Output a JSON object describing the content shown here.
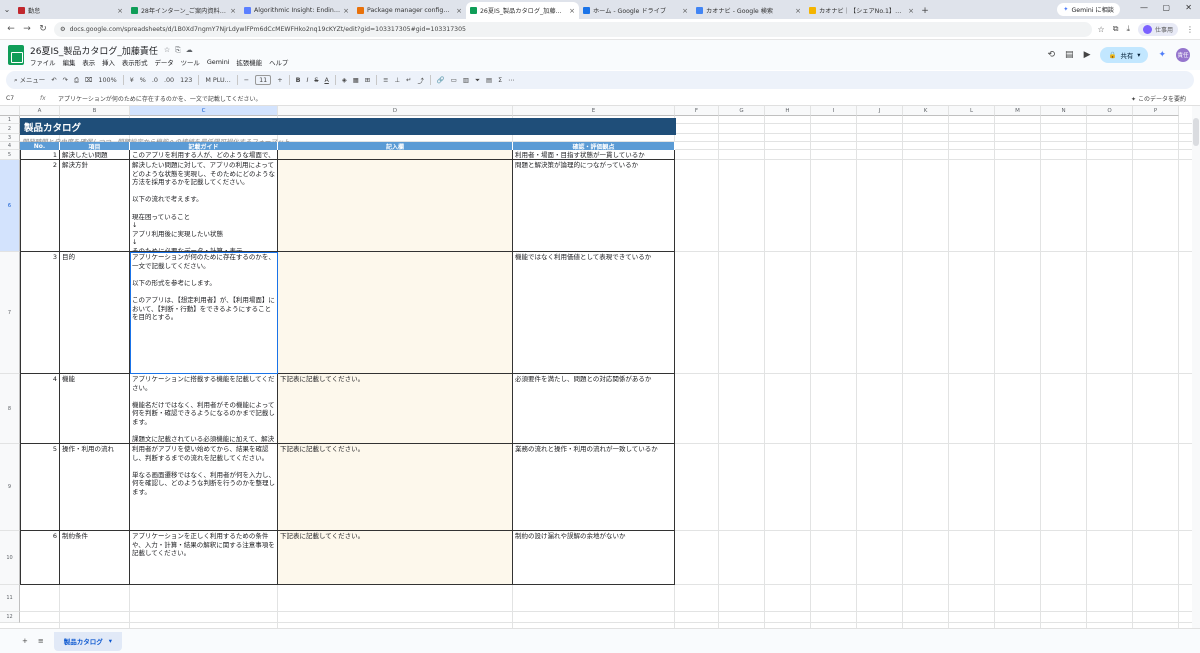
{
  "browser": {
    "tabs": [
      {
        "label": "勤怠",
        "color": "#c1272d",
        "active": false
      },
      {
        "label": "28年インターン_ご案内資料 - Go",
        "color": "#0f9d58",
        "active": false
      },
      {
        "label": "Algorithmic Insight: Ending To",
        "color": "#5b7fff",
        "active": false
      },
      {
        "label": "Package manager configuratio",
        "color": "#e8710a",
        "active": false
      },
      {
        "label": "26夏IS_製品カタログ_加藤責任",
        "color": "#0f9d58",
        "active": true
      },
      {
        "label": "ホーム - Google ドライブ",
        "color": "#1a73e8",
        "active": false
      },
      {
        "label": "カオナビ - Google 検索",
        "color": "#4285f4",
        "active": false
      },
      {
        "label": "カオナビ｜【シェアNo.1】タレントマネ",
        "color": "#f4b400",
        "active": false
      }
    ],
    "gemini_button": "Gemini に相談",
    "url": "docs.google.com/spreadsheets/d/1B0Xd7ngmY7NjrLdywlFPm6dCcMEWFHko2nq19cKYZt/edit?gid=103317305#gid=103317305",
    "profile_label": "仕事用"
  },
  "doc": {
    "title": "26夏IS_製品カタログ_加藤責任",
    "menu": [
      "ファイル",
      "編集",
      "表示",
      "挿入",
      "表示形式",
      "データ",
      "ツール",
      "Gemini",
      "拡張機能",
      "ヘルプ"
    ],
    "share_label": "共有",
    "avatar_label": "責任"
  },
  "toolbar": {
    "menu_label": "メニュー",
    "zoom": "100%",
    "currency": "¥",
    "percent": "%",
    "decimal_dec": ".0",
    "decimal_inc": ".00",
    "format_123": "123",
    "font": "M PLU...",
    "font_size": "11"
  },
  "formula_bar": {
    "cell_ref": "C7",
    "content": "アプリケーションが何のために存在するのかを、一文で記載してください。",
    "right_label": "このデータを要約"
  },
  "columns": [
    "A",
    "B",
    "C",
    "D",
    "E",
    "F",
    "G",
    "H",
    "I",
    "J",
    "K",
    "L",
    "M",
    "N",
    "O",
    "P"
  ],
  "rows": [
    "1",
    "2",
    "3",
    "4",
    "5",
    "6",
    "7",
    "8",
    "9",
    "10",
    "11",
    "12"
  ],
  "sheet": {
    "title": "製品カタログ",
    "subtitle": "開発時間と自由度を確保しつつ、問題設定から機能への接続を最低限可視化するフォーマット",
    "headers": [
      "No.",
      "項目",
      "記載ガイド",
      "記入欄",
      "確認・評価観点"
    ],
    "items": [
      {
        "no": "1",
        "item": "解決したい問題",
        "guide": "このアプリを利用する人が、どのような場面で、何に困っているかを記載してください。\n\n単に「人材配置を最適化できない」と書くのではなく、以下が分かるようにしてください。\n\n誰が使うのか\nいつ使うのか\n何を判断する必要があるのか\nなぜ現在の方法では判断が難しいのか",
        "entry": "",
        "check": "利用者・場面・目指す状態が一貫しているか"
      },
      {
        "no": "2",
        "item": "解決方針",
        "guide": "解決したい問題に対して、アプリの利用によってどのような状態を実現し、そのためにどのような方法を採用するかを記載してください。\n\n以下の流れで考えます。\n\n現在困っていること\n↓\nアプリ利用後に実現したい状態\n↓\nそのために必要なデータ・計算・表示\n\n細かなボタンや画面構成ではなく、アプリ全体としての解決方法を整理してください。",
        "entry": "",
        "check": "問題と解決策が論理的につながっているか"
      },
      {
        "no": "3",
        "item": "目的",
        "guide": "アプリケーションが何のために存在するのかを、一文で記載してください。\n\n以下の形式を参考にします。\n\nこのアプリは、【想定利用者】が、【利用場面】において、【判断・行動】をできるようにすることを目的とする。",
        "entry": "",
        "check": "機能ではなく利用価値として表現できているか"
      },
      {
        "no": "4",
        "item": "機能",
        "guide": "アプリケーションに搭載する機能を記載してください。\n\n機能名だけではなく、利用者がその機能によって何を判断・確認できるようになるのかまで記載します。\n\n課題文に記載されている必須機能に加えて、解決したい問題を踏まえて必要だと考えた機能を追加できます。",
        "entry": "下記表に記載してください。",
        "check": "必須要件を満たし、問題との対応関係があるか"
      },
      {
        "no": "5",
        "item": "操作・利用の流れ",
        "guide": "利用者がアプリを使い始めてから、結果を確認し、判断するまでの流れを記載してください。\n\n単なる画面遷移ではなく、利用者が何を入力し、何を確認し、どのような判断を行うのかを整理します。",
        "entry": "下記表に記載してください。",
        "check": "業務の流れと操作・利用の流れが一致しているか"
      },
      {
        "no": "6",
        "item": "制約条件",
        "guide": "アプリケーションを正しく利用するための条件や、入力・計算・結果の解釈に関する注意事項を記載してください。",
        "entry": "下記表に記載してください。",
        "check": "制約の設け漏れや誤解の余地がないか"
      }
    ]
  },
  "sheet_tab": "製品カタログ",
  "colors": {
    "title_band": "#1f4e79",
    "table_header": "#5b9bd5",
    "input_fill": "#fdf8ec",
    "selection": "#1a73e8"
  }
}
